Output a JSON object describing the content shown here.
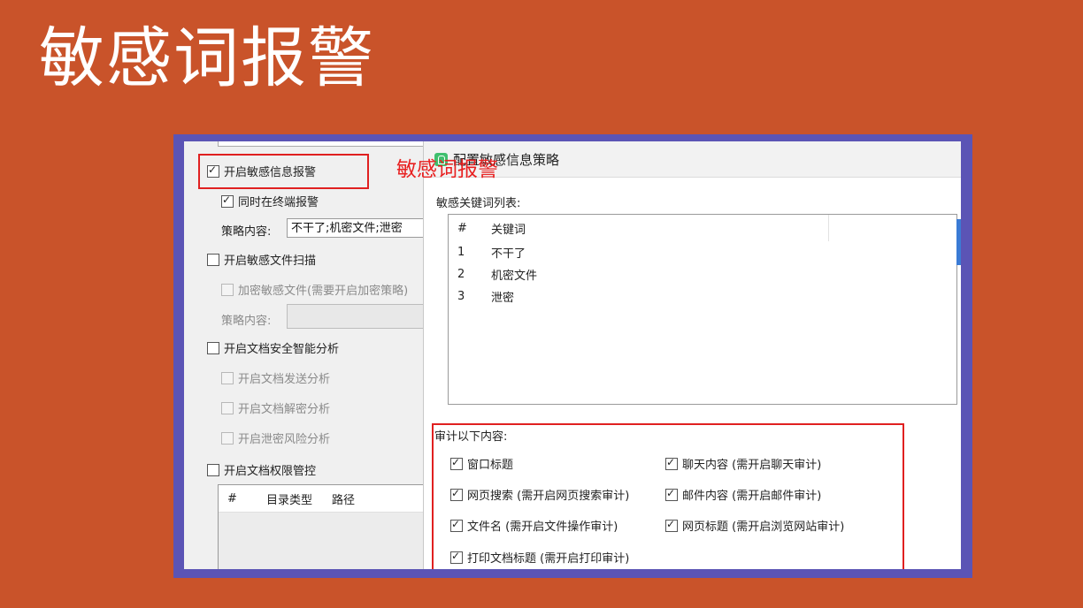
{
  "slide_title": "敏感词报警",
  "annotation": "敏感词报警",
  "left_panel": {
    "enable_sensitive_alert": "开启敏感信息报警",
    "terminal_alert": "同时在终端报警",
    "policy_label": "策略内容:",
    "policy_value": "不干了;机密文件;泄密",
    "enable_file_scan": "开启敏感文件扫描",
    "encrypt_sensitive": "加密敏感文件(需要开启加密策略)",
    "policy_label2": "策略内容:",
    "enable_doc_ai": "开启文档安全智能分析",
    "doc_send": "开启文档发送分析",
    "doc_decrypt": "开启文档解密分析",
    "leak_risk": "开启泄密风险分析",
    "doc_permission": "开启文档权限管控",
    "dir_table_headers": [
      "#",
      "目录类型",
      "路径"
    ]
  },
  "dialog": {
    "title": "配置敏感信息策略",
    "keyword_list_label": "敏感关键词列表:",
    "keyword_headers": [
      "#",
      "关键词"
    ],
    "keywords": [
      {
        "num": "1",
        "kw": "不干了"
      },
      {
        "num": "2",
        "kw": "机密文件"
      },
      {
        "num": "3",
        "kw": "泄密"
      }
    ],
    "audit_label": "审计以下内容:",
    "audit_items": [
      "窗口标题",
      "聊天内容 (需开启聊天审计)",
      "网页搜索 (需开启网页搜索审计)",
      "邮件内容 (需开启邮件审计)",
      "文件名 (需开启文件操作审计)",
      "网页标题 (需开启浏览网站审计)",
      "打印文档标题 (需开启打印审计)"
    ]
  },
  "colors": {
    "background": "#c9532a",
    "frame": "#5b54b5",
    "highlight": "#e02020"
  }
}
